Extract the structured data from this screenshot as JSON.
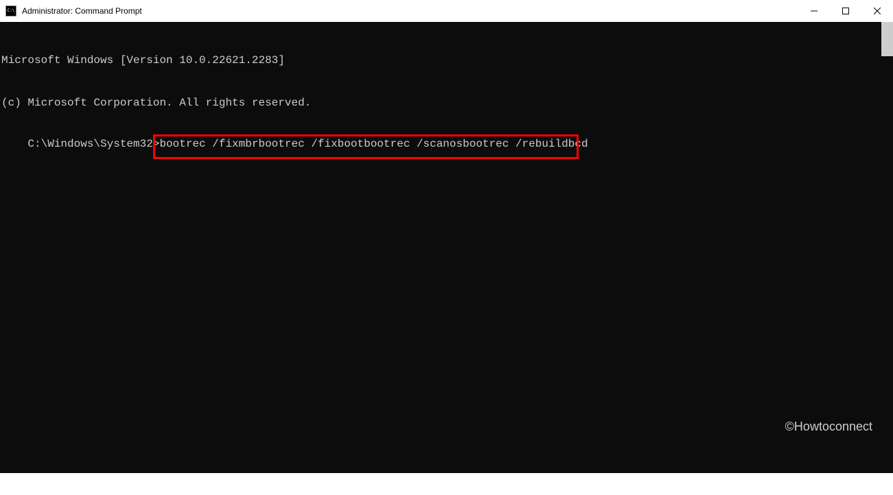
{
  "titlebar": {
    "title": "Administrator: Command Prompt"
  },
  "terminal": {
    "line1": "Microsoft Windows [Version 10.0.22621.2283]",
    "line2": "(c) Microsoft Corporation. All rights reserved.",
    "prompt": "C:\\Windows\\System32>",
    "command": "bootrec /fixmbrbootrec /fixbootbootrec /scanosbootrec /rebuildbcd"
  },
  "watermark": "©Howtoconnect"
}
